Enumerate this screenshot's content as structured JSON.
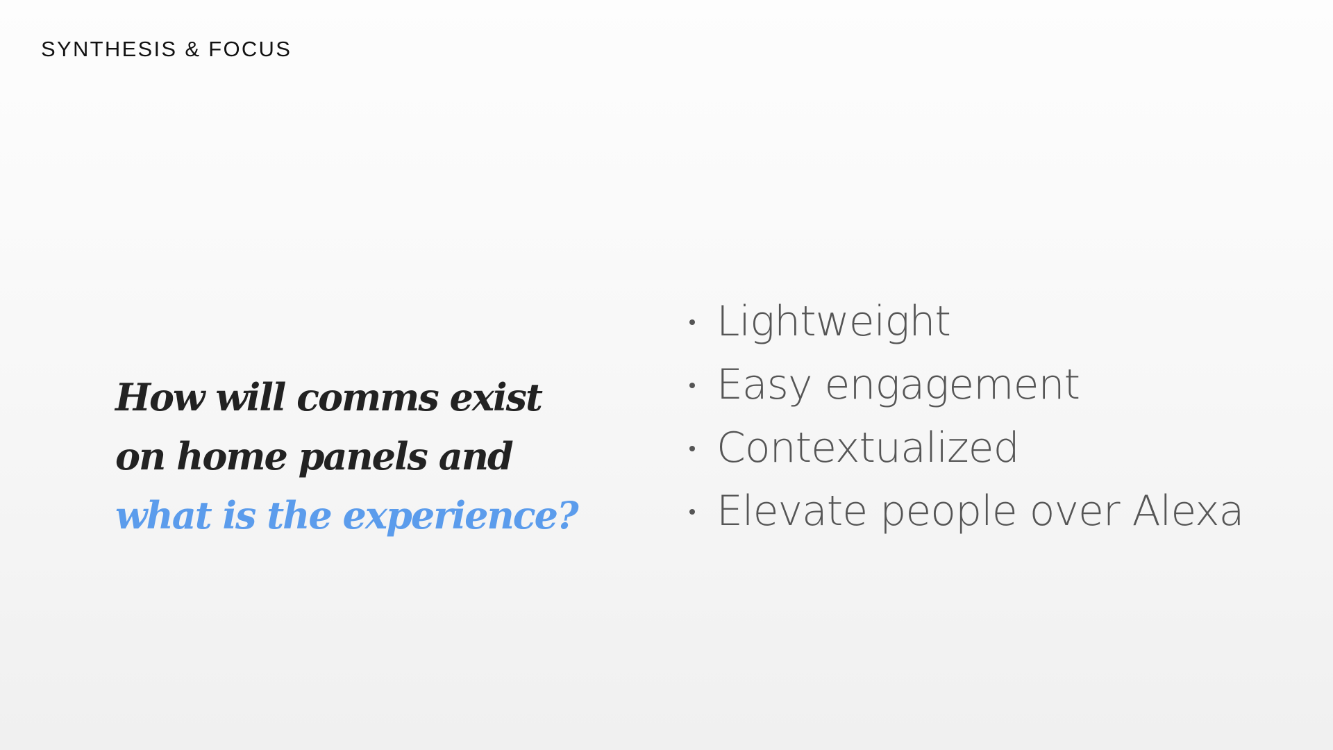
{
  "header": {
    "section_label": "SYNTHESIS & FOCUS"
  },
  "question": {
    "line1": "How will comms exist",
    "line2": "on home panels and",
    "line3_accent": "what is the experience?"
  },
  "bullets": [
    {
      "label": "Lightweight"
    },
    {
      "label": "Easy engagement"
    },
    {
      "label": "Contextualized"
    },
    {
      "label": "Elevate people over Alexa"
    }
  ],
  "colors": {
    "accent": "#5b9cec",
    "heading": "#222222",
    "body": "#555555"
  }
}
